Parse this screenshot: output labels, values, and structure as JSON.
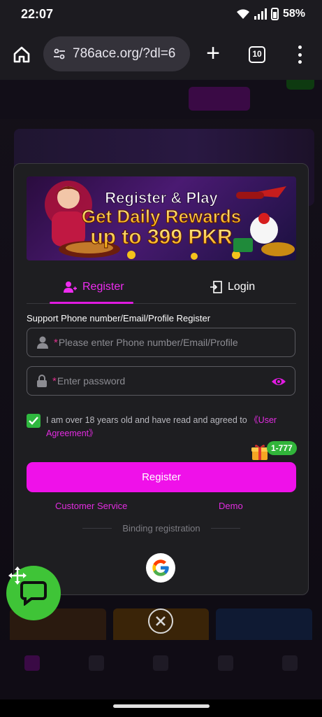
{
  "status_bar": {
    "time": "22:07",
    "battery": "58%"
  },
  "browser": {
    "url": "786ace.org/?dl=6",
    "tab_count": "10"
  },
  "banner": {
    "line1": "Register & Play",
    "line2": "Get Daily Rewards",
    "line3": "up to 399 PKR"
  },
  "tabs": {
    "register": "Register",
    "login": "Login"
  },
  "form": {
    "hint": "Support Phone number/Email/Profile Register",
    "phone_placeholder": "Please enter Phone number/Email/Profile",
    "password_placeholder": "Enter password",
    "required_mark": "*",
    "agree_text": "I am over 18 years old and have read and agreed to ",
    "agree_link": "《User Agreement》",
    "agree_checked": true,
    "register_button": "Register"
  },
  "gift_badge": "1-777",
  "links": {
    "customer_service": "Customer Service",
    "demo": "Demo"
  },
  "binding": {
    "label": "Binding registration"
  },
  "colors": {
    "accent": "#ef11e9",
    "check": "#2fb83f",
    "modal_bg": "#1e1e21",
    "chat_fab": "#3fc437"
  },
  "icons": {
    "home": "home-icon",
    "site_info": "tune-icon",
    "new_tab": "plus-icon",
    "tabs": "tabs-count-icon",
    "menu": "more-vert-icon",
    "register_tab": "add-user-icon",
    "login_tab": "login-door-icon",
    "user": "user-icon",
    "lock": "lock-icon",
    "eye": "eye-icon",
    "check": "check-icon",
    "gift": "gift-icon",
    "google": "google-icon",
    "close": "close-circle-icon",
    "chat": "chat-icon",
    "move": "move-icon"
  }
}
